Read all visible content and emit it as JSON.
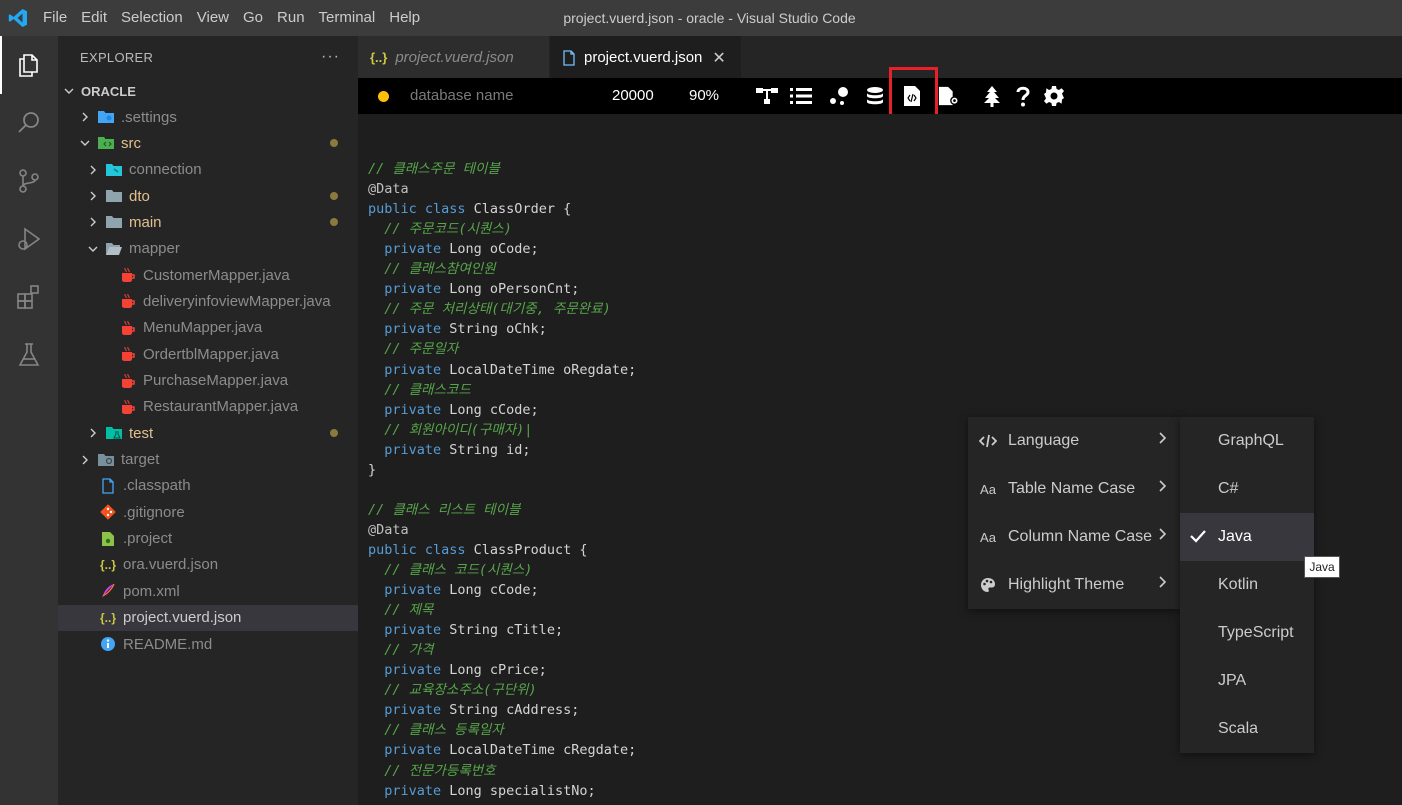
{
  "window": {
    "title": "project.vuerd.json - oracle - Visual Studio Code",
    "menu": [
      "File",
      "Edit",
      "Selection",
      "View",
      "Go",
      "Run",
      "Terminal",
      "Help"
    ]
  },
  "activity_bar": [
    "explorer-icon",
    "search-icon",
    "source-control-icon",
    "run-debug-icon",
    "extensions-icon",
    "testing-icon"
  ],
  "explorer": {
    "title": "EXPLORER",
    "more": "···",
    "root": "ORACLE",
    "items": [
      {
        "label": ".settings",
        "kind": "folder-settings",
        "expanded": false,
        "depth": 1,
        "modified": false
      },
      {
        "label": "src",
        "kind": "folder-src",
        "expanded": true,
        "depth": 1,
        "modified": true
      },
      {
        "label": "connection",
        "kind": "folder-connection",
        "expanded": false,
        "depth": 2,
        "modified": false
      },
      {
        "label": "dto",
        "kind": "folder",
        "expanded": false,
        "depth": 2,
        "modified": true
      },
      {
        "label": "main",
        "kind": "folder",
        "expanded": false,
        "depth": 2,
        "modified": true
      },
      {
        "label": "mapper",
        "kind": "folder-open",
        "expanded": true,
        "depth": 2,
        "modified": false
      },
      {
        "label": "CustomerMapper.java",
        "kind": "java",
        "depth": 3,
        "modified": false
      },
      {
        "label": "deliveryinfoviewMapper.java",
        "kind": "java",
        "depth": 3,
        "modified": false
      },
      {
        "label": "MenuMapper.java",
        "kind": "java",
        "depth": 3,
        "modified": false
      },
      {
        "label": "OrdertblMapper.java",
        "kind": "java",
        "depth": 3,
        "modified": false
      },
      {
        "label": "PurchaseMapper.java",
        "kind": "java",
        "depth": 3,
        "modified": false
      },
      {
        "label": "RestaurantMapper.java",
        "kind": "java",
        "depth": 3,
        "modified": false
      },
      {
        "label": "test",
        "kind": "folder-test",
        "expanded": false,
        "depth": 2,
        "modified": true
      },
      {
        "label": "target",
        "kind": "folder-target",
        "expanded": false,
        "depth": 1,
        "modified": false
      },
      {
        "label": ".classpath",
        "kind": "file",
        "depth": 1,
        "modified": false
      },
      {
        "label": ".gitignore",
        "kind": "git",
        "depth": 1,
        "modified": false
      },
      {
        "label": ".project",
        "kind": "project",
        "depth": 1,
        "modified": false
      },
      {
        "label": "ora.vuerd.json",
        "kind": "json",
        "depth": 1,
        "modified": false
      },
      {
        "label": "pom.xml",
        "kind": "xml",
        "depth": 1,
        "modified": false
      },
      {
        "label": "project.vuerd.json",
        "kind": "json",
        "depth": 1,
        "modified": false,
        "selected": true
      },
      {
        "label": "README.md",
        "kind": "info",
        "depth": 1,
        "modified": false
      }
    ]
  },
  "tabs": [
    {
      "label": "project.vuerd.json",
      "active": false,
      "icon": "json-icon"
    },
    {
      "label": "project.vuerd.json",
      "active": true,
      "icon": "file-icon",
      "close": "✕"
    }
  ],
  "erd_toolbar": {
    "database_name": "database name",
    "canvas_size": "20000",
    "zoom": "90%",
    "status_color": "#ffc107"
  },
  "code_lines": [
    {
      "tokens": [
        {
          "t": "cm",
          "v": "// 클래스주문 테이블"
        }
      ]
    },
    {
      "tokens": [
        {
          "t": "an",
          "v": "@Data"
        }
      ]
    },
    {
      "tokens": [
        {
          "t": "kw",
          "v": "public class "
        },
        {
          "t": "tx",
          "v": "ClassOrder {"
        }
      ]
    },
    {
      "tokens": [
        {
          "t": "cm",
          "v": "  // 주문코드(시퀀스)"
        }
      ]
    },
    {
      "tokens": [
        {
          "t": "kw",
          "v": "  private "
        },
        {
          "t": "tx",
          "v": "Long oCode;"
        }
      ]
    },
    {
      "tokens": [
        {
          "t": "cm",
          "v": "  // 클래스참여인원"
        }
      ]
    },
    {
      "tokens": [
        {
          "t": "kw",
          "v": "  private "
        },
        {
          "t": "tx",
          "v": "Long oPersonCnt;"
        }
      ]
    },
    {
      "tokens": [
        {
          "t": "cm",
          "v": "  // 주문 처리상태(대기중, 주문완료)"
        }
      ]
    },
    {
      "tokens": [
        {
          "t": "kw",
          "v": "  private "
        },
        {
          "t": "tx",
          "v": "String oChk;"
        }
      ]
    },
    {
      "tokens": [
        {
          "t": "cm",
          "v": "  // 주문일자"
        }
      ]
    },
    {
      "tokens": [
        {
          "t": "kw",
          "v": "  private "
        },
        {
          "t": "tx",
          "v": "LocalDateTime oRegdate;"
        }
      ]
    },
    {
      "tokens": [
        {
          "t": "cm",
          "v": "  // 클래스코드"
        }
      ]
    },
    {
      "tokens": [
        {
          "t": "kw",
          "v": "  private "
        },
        {
          "t": "tx",
          "v": "Long cCode;"
        }
      ]
    },
    {
      "tokens": [
        {
          "t": "cm",
          "v": "  // 회원아이디(구매자)|"
        }
      ]
    },
    {
      "tokens": [
        {
          "t": "kw",
          "v": "  private "
        },
        {
          "t": "tx",
          "v": "String id;"
        }
      ]
    },
    {
      "tokens": [
        {
          "t": "tx",
          "v": "}"
        }
      ]
    },
    {
      "tokens": []
    },
    {
      "tokens": [
        {
          "t": "cm",
          "v": "// 클래스 리스트 테이블"
        }
      ]
    },
    {
      "tokens": [
        {
          "t": "an",
          "v": "@Data"
        }
      ]
    },
    {
      "tokens": [
        {
          "t": "kw",
          "v": "public class "
        },
        {
          "t": "tx",
          "v": "ClassProduct {"
        }
      ]
    },
    {
      "tokens": [
        {
          "t": "cm",
          "v": "  // 클래스 코드(시퀀스)"
        }
      ]
    },
    {
      "tokens": [
        {
          "t": "kw",
          "v": "  private "
        },
        {
          "t": "tx",
          "v": "Long cCode;"
        }
      ]
    },
    {
      "tokens": [
        {
          "t": "cm",
          "v": "  // 제목"
        }
      ]
    },
    {
      "tokens": [
        {
          "t": "kw",
          "v": "  private "
        },
        {
          "t": "tx",
          "v": "String cTitle;"
        }
      ]
    },
    {
      "tokens": [
        {
          "t": "cm",
          "v": "  // 가격"
        }
      ]
    },
    {
      "tokens": [
        {
          "t": "kw",
          "v": "  private "
        },
        {
          "t": "tx",
          "v": "Long cPrice;"
        }
      ]
    },
    {
      "tokens": [
        {
          "t": "cm",
          "v": "  // 교육장소주소(구단위)"
        }
      ]
    },
    {
      "tokens": [
        {
          "t": "kw",
          "v": "  private "
        },
        {
          "t": "tx",
          "v": "String cAddress;"
        }
      ]
    },
    {
      "tokens": [
        {
          "t": "cm",
          "v": "  // 클래스 등록일자"
        }
      ]
    },
    {
      "tokens": [
        {
          "t": "kw",
          "v": "  private "
        },
        {
          "t": "tx",
          "v": "LocalDateTime cRegdate;"
        }
      ]
    },
    {
      "tokens": [
        {
          "t": "cm",
          "v": "  // 전문가등록번호"
        }
      ]
    },
    {
      "tokens": [
        {
          "t": "kw",
          "v": "  private "
        },
        {
          "t": "tx",
          "v": "Long specialistNo;"
        }
      ]
    },
    {
      "tokens": [
        {
          "t": "tx",
          "v": "}"
        }
      ]
    }
  ],
  "context_menu": {
    "items": [
      {
        "label": "Language",
        "icon": "code-icon"
      },
      {
        "label": "Table Name Case",
        "icon": "Aa"
      },
      {
        "label": "Column Name Case",
        "icon": "Aa"
      },
      {
        "label": "Highlight Theme",
        "icon": "palette-icon"
      }
    ],
    "languages": [
      "GraphQL",
      "C#",
      "Java",
      "Kotlin",
      "TypeScript",
      "JPA",
      "Scala"
    ],
    "selected_language": "Java",
    "tooltip": "Java"
  },
  "colors": {
    "accent_highlight": "#e8202a",
    "comment": "#57a64a",
    "keyword": "#569cd6"
  }
}
